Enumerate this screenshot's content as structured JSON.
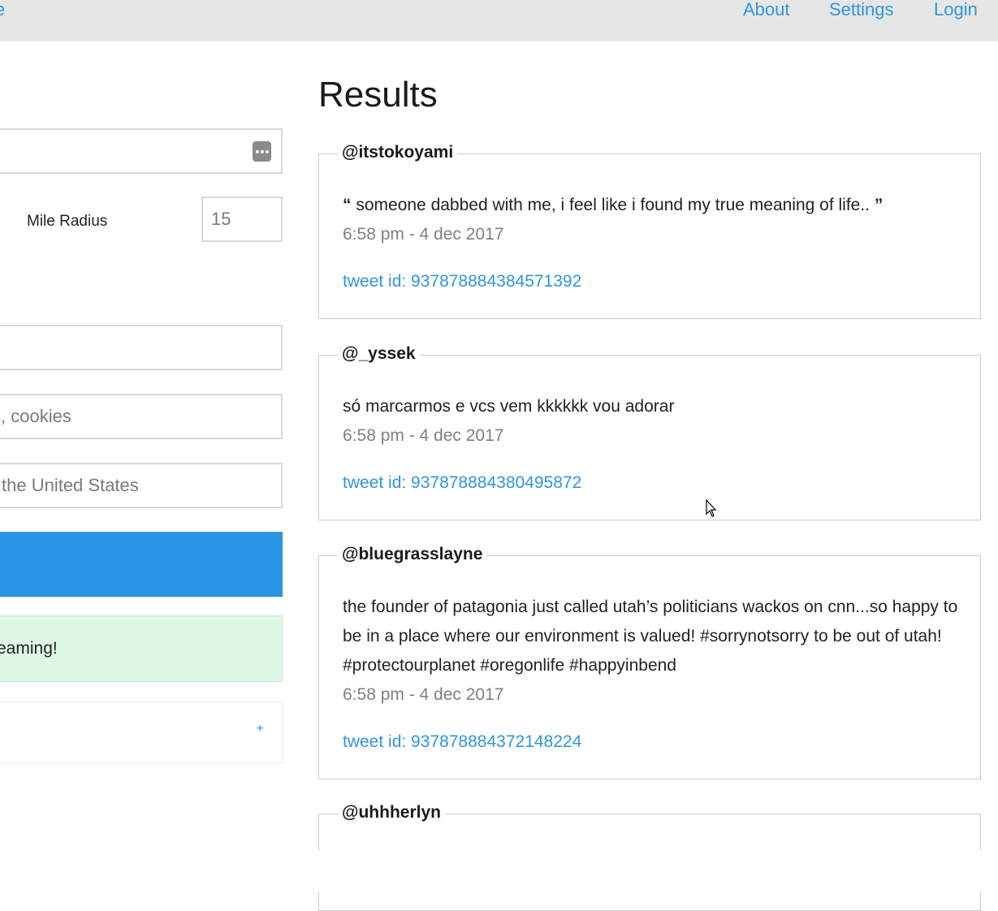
{
  "nav": {
    "brand_fragment": "e",
    "links": [
      "About",
      "Settings",
      "Login"
    ]
  },
  "form": {
    "radius_label": "Mile Radius",
    "radius_value": "15",
    "keywords_placeholder_fragment": "s, cookies",
    "location_placeholder_fragment": "the United States",
    "notice_fragment": "reaming!",
    "expand_symbol": "+"
  },
  "results": {
    "title": "Results",
    "tweets": [
      {
        "user": "@itstokoyami",
        "open_quote": "“",
        "text": "someone dabbed with me, i feel like i found my true meaning of life..",
        "close_quote": "”",
        "time": "6:58 pm - 4 dec 2017",
        "id": "tweet id: 937878884384571392"
      },
      {
        "user": "@_yssek",
        "text": "só marcarmos e vcs vem kkkkkk vou adorar",
        "time": "6:58 pm - 4 dec 2017",
        "id": "tweet id: 937878884380495872"
      },
      {
        "user": "@bluegrasslayne",
        "text": "the founder of patagonia just called utah’s politicians wackos on cnn...so happy to be in a place where our environment is valued! #sorrynotsorry to be out of utah! #protectourplanet #oregonlife #happyinbend",
        "time": "6:58 pm - 4 dec 2017",
        "id": "tweet id: 937878884372148224"
      },
      {
        "user": "@uhhherlyn"
      }
    ]
  },
  "colors": {
    "accent": "#2a94e4",
    "link": "#2f96e0",
    "navbar_bg": "#e6e6e6",
    "notice_bg": "#dff8e6"
  }
}
